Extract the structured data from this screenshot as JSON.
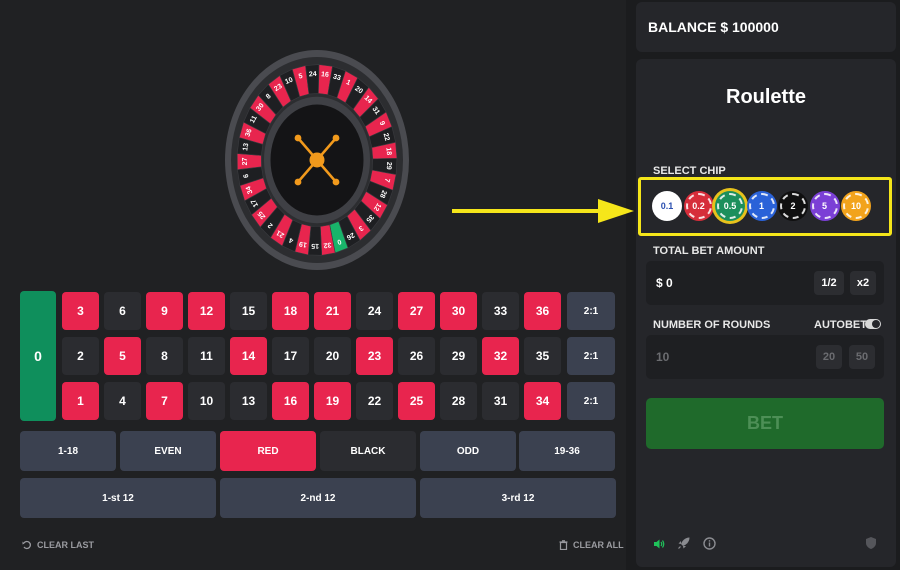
{
  "wheel": {
    "numbers": [
      "0",
      "32",
      "15",
      "19",
      "4",
      "21",
      "2",
      "25",
      "17",
      "34",
      "6",
      "27",
      "13",
      "36",
      "11",
      "30",
      "8",
      "23",
      "10",
      "5",
      "24",
      "16",
      "33",
      "1",
      "20",
      "14",
      "31",
      "9",
      "22",
      "18",
      "29",
      "7",
      "28",
      "12",
      "35",
      "3",
      "26"
    ],
    "colors": {
      "red": "#e8254e",
      "black": "#1e1f22",
      "green": "#19b46a",
      "hub": "#f29a1c"
    }
  },
  "board": {
    "zero": "0",
    "rows": [
      [
        "3",
        "6",
        "9",
        "12",
        "15",
        "18",
        "21",
        "24",
        "27",
        "30",
        "33",
        "36"
      ],
      [
        "2",
        "5",
        "8",
        "11",
        "14",
        "17",
        "20",
        "23",
        "26",
        "29",
        "32",
        "35"
      ],
      [
        "1",
        "4",
        "7",
        "10",
        "13",
        "16",
        "19",
        "22",
        "25",
        "28",
        "31",
        "34"
      ]
    ],
    "red_numbers": [
      "1",
      "3",
      "5",
      "7",
      "9",
      "12",
      "14",
      "16",
      "18",
      "19",
      "21",
      "23",
      "25",
      "27",
      "30",
      "32",
      "34",
      "36"
    ],
    "columns": [
      "2:1",
      "2:1",
      "2:1"
    ],
    "outside": [
      "1-18",
      "EVEN",
      "RED",
      "BLACK",
      "ODD",
      "19-36"
    ],
    "dozens": [
      "1-st 12",
      "2-nd 12",
      "3-rd 12"
    ]
  },
  "footer": {
    "clear_last": "CLEAR LAST",
    "clear_all": "CLEAR ALL"
  },
  "balance": {
    "label": "BALANCE $ 100000"
  },
  "panel": {
    "title": "Roulette",
    "select_chip_label": "SELECT CHIP",
    "chips": [
      {
        "value": "0.1",
        "color": "#ffffff",
        "text_color": "#2a4fb0"
      },
      {
        "value": "0.2",
        "color": "#d62d3a",
        "text_color": "#ffffff"
      },
      {
        "value": "0.5",
        "color": "#1c8f5c",
        "text_color": "#ffffff"
      },
      {
        "value": "1",
        "color": "#2a62d8",
        "text_color": "#ffffff"
      },
      {
        "value": "2",
        "color": "#101010",
        "text_color": "#ffffff"
      },
      {
        "value": "5",
        "color": "#7b3fd6",
        "text_color": "#ffffff"
      },
      {
        "value": "10",
        "color": "#f2a31c",
        "text_color": "#ffffff"
      }
    ],
    "selected_chip": "0.5",
    "total_bet_label": "TOTAL BET AMOUNT",
    "total_bet_value": "$  0",
    "half_label": "1/2",
    "double_label": "x2",
    "rounds_label": "NUMBER OF ROUNDS",
    "autobet_label": "AUTOBET",
    "rounds_value": "10",
    "rounds_opt_1": "20",
    "rounds_opt_2": "50",
    "bet_label": "BET"
  },
  "annotation": {
    "arrow_color": "#f5e61a"
  }
}
